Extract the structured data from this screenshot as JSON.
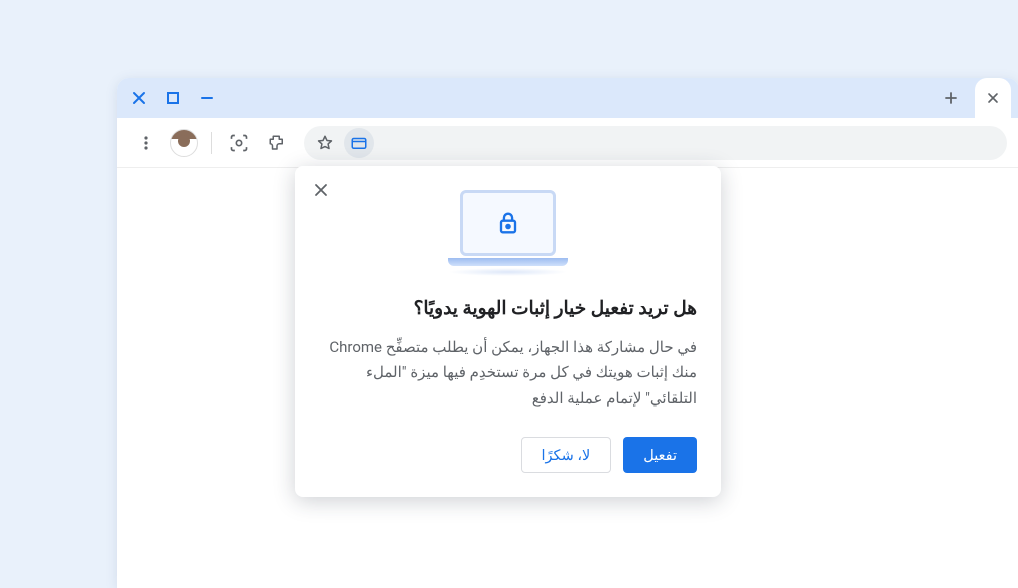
{
  "popover": {
    "title": "هل تريد تفعيل خيار إثبات الهوية يدويًا؟",
    "body": "في حال مشاركة هذا الجهاز، يمكن أن يطلب متصفِّح Chrome منك إثبات هويتك في كل مرة تستخدِم فيها ميزة \"الملء التلقائي\" لإتمام عملية الدفع",
    "primary": "تفعيل",
    "secondary": "لا، شكرًا"
  }
}
